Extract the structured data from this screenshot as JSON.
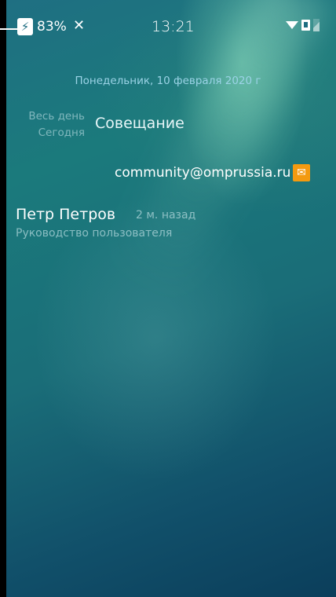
{
  "status_bar": {
    "battery": "83%",
    "time": "13:21",
    "icons": [
      "charging-bolt-icon",
      "tools-icon",
      "wifi-icon",
      "sim-icon",
      "signal-icon"
    ]
  },
  "events": {
    "date": "Понедельник, 10 февраля 2020 г",
    "all_day": "Весь день",
    "today": "Сегодня",
    "title": "Совещание"
  },
  "notifications": {
    "email_account": "community@omprussia.ru",
    "sender": "Петр Петров",
    "time_ago": "2 м. назад",
    "subject": "Руководство пользователя"
  },
  "colors": {
    "accent_date": "#9bd3e6",
    "exchange_badge": "#f39a10"
  }
}
